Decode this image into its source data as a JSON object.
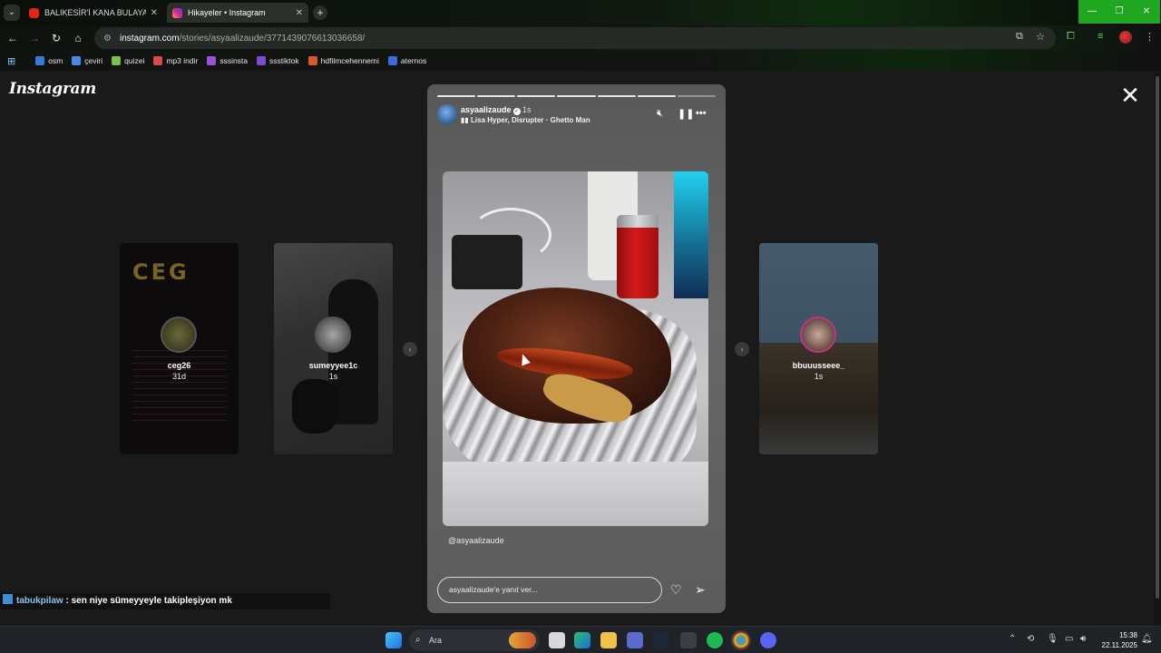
{
  "browser": {
    "tabs": [
      {
        "title": "BALIKESİR'İ KANA BULAYAN PS",
        "favicon_color": "#e62117"
      },
      {
        "title": "Hikayeler • Instagram",
        "favicon_color": "#d6249f"
      }
    ],
    "url_host": "instagram.com",
    "url_path": "/stories/asyaalizaude/3771439076613036658/",
    "bookmarks": [
      {
        "label": "osm",
        "color": "#3b7bd8"
      },
      {
        "label": "çeviri",
        "color": "#4a88e8"
      },
      {
        "label": "quizei",
        "color": "#7bbf4a"
      },
      {
        "label": "mp3 indir",
        "color": "#d84a4a"
      },
      {
        "label": "sssinsta",
        "color": "#9a52d8"
      },
      {
        "label": "ssstiktok",
        "color": "#7d4ad8"
      },
      {
        "label": "hdfilmcehennemi",
        "color": "#d85a2a"
      },
      {
        "label": "aternos",
        "color": "#3a6bd8"
      }
    ]
  },
  "instagram": {
    "logo": "Instagram",
    "close_icon": "close-icon",
    "main_story": {
      "username": "asyaalizaude",
      "time": "1s",
      "music": "Lisa Hyper, Disrupter · Ghetto Man",
      "mention": "@asyaalizaude",
      "reply_placeholder": "asyaalizaude'e yanıt ver...",
      "segments_total": 7,
      "segments_done": 6
    },
    "side_stories": [
      {
        "username": "ceg26",
        "time": "31d",
        "logo_text": "CEG"
      },
      {
        "username": "sumeyyee1c",
        "time": "1s"
      },
      {
        "username": "bbuuusseee_",
        "time": "1s"
      }
    ]
  },
  "chat_overlay": {
    "user": "tabukpilaw",
    "message": " : sen niye sümeyyeyle takipleşiyon mk"
  },
  "taskbar": {
    "search_label": "Ara",
    "time": "15:38",
    "date": "22.11.2025"
  }
}
